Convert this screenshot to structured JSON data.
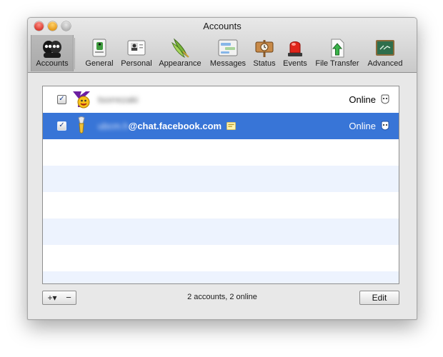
{
  "window": {
    "title": "Accounts"
  },
  "toolbar": {
    "items": [
      {
        "label": "Accounts",
        "icon": "accounts-icon"
      },
      {
        "label": "General",
        "icon": "general-icon"
      },
      {
        "label": "Personal",
        "icon": "personal-icon"
      },
      {
        "label": "Appearance",
        "icon": "appearance-icon"
      },
      {
        "label": "Messages",
        "icon": "messages-icon"
      },
      {
        "label": "Status",
        "icon": "status-icon"
      },
      {
        "label": "Events",
        "icon": "events-icon"
      },
      {
        "label": "File Transfer",
        "icon": "file-transfer-icon"
      },
      {
        "label": "Advanced",
        "icon": "advanced-icon"
      }
    ]
  },
  "accounts": [
    {
      "checked": "✓",
      "name_blurred": "tsorrezaki",
      "domain": "",
      "status": "Online",
      "service": "yahoo-icon"
    },
    {
      "checked": "✓",
      "name_blurred": "ubcm.h",
      "domain": "@chat.facebook.com",
      "status": "Online",
      "service": "facebook-jabber-icon"
    }
  ],
  "footer": {
    "add_label": "+▾",
    "remove_label": "−",
    "summary": "2 accounts, 2 online",
    "edit_label": "Edit"
  },
  "colors": {
    "selection": "#3875d7",
    "alt_row": "#edf3fe"
  }
}
